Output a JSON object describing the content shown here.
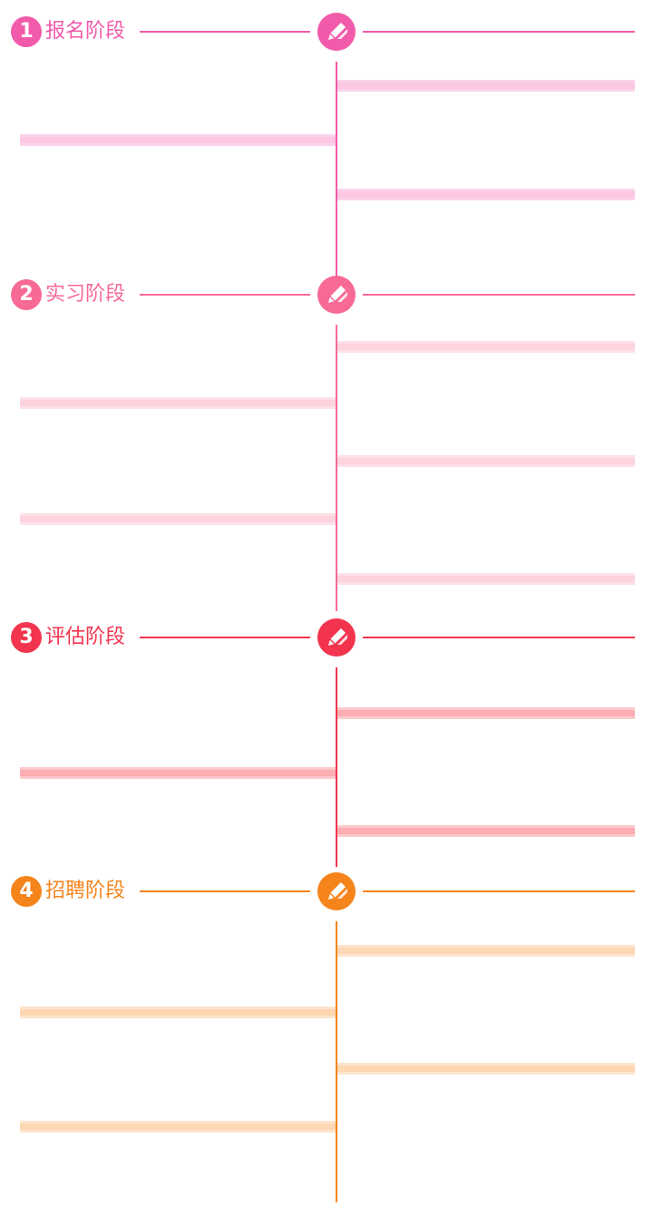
{
  "stages": [
    {
      "number": "1",
      "title": "报名阶段",
      "color": "#f25aaa",
      "bar_color": "#fbd3ea",
      "bar_core": "#fcc8e4",
      "icon": "pencil-icon"
    },
    {
      "number": "2",
      "title": "实习阶段",
      "color": "#f76a96",
      "bar_color": "#fde0e8",
      "bar_core": "#fdd3de",
      "icon": "pencil-icon"
    },
    {
      "number": "3",
      "title": "评估阶段",
      "color": "#f2344f",
      "bar_color": "#fdc9cc",
      "bar_core": "#fcaeb2",
      "icon": "pencil-icon"
    },
    {
      "number": "4",
      "title": "招聘阶段",
      "color": "#f5841b",
      "bar_color": "#fde4cc",
      "bar_core": "#fdd7b3",
      "icon": "pencil-icon"
    }
  ]
}
